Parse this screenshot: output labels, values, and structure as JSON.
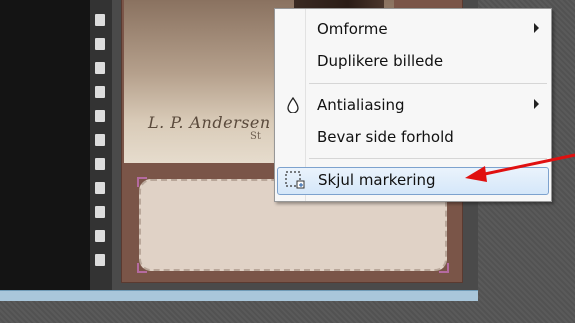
{
  "menu": {
    "items": [
      {
        "label": "Omforme",
        "submenu": true,
        "icon": null
      },
      {
        "label": "Duplikere billede",
        "submenu": false,
        "icon": null
      },
      {
        "label": "Antialiasing",
        "submenu": true,
        "icon": "drop-icon"
      },
      {
        "label": "Bevar side forhold",
        "submenu": false,
        "icon": null
      },
      {
        "label": "Skjul markering",
        "submenu": false,
        "icon": "hide-selection-icon",
        "highlighted": true
      }
    ]
  },
  "photo": {
    "signature": "L. P. Andersen",
    "subtext": "St"
  },
  "colors": {
    "arrow": "#e01010",
    "highlight_border": "#7da2ce",
    "card": "#7a5548"
  }
}
